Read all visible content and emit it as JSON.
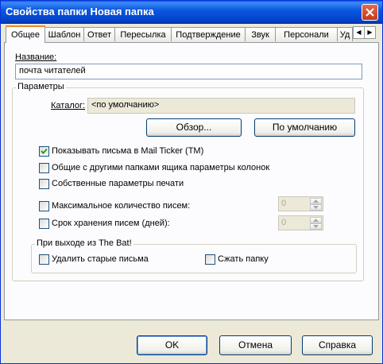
{
  "window": {
    "title": "Свойства папки Новая папка"
  },
  "tabs": [
    {
      "label": "Общее"
    },
    {
      "label": "Шаблон"
    },
    {
      "label": "Ответ"
    },
    {
      "label": "Пересылка"
    },
    {
      "label": "Подтверждение"
    },
    {
      "label": "Звук"
    },
    {
      "label": "Персонали"
    },
    {
      "label": "Уд"
    }
  ],
  "general": {
    "name_label": "Название:",
    "name_value": "почта читателей",
    "params_title": "Параметры",
    "catalog_label": "Каталог:",
    "catalog_value": "<по умолчанию>",
    "browse_button": "Обзор...",
    "default_button": "По умолчанию",
    "options": [
      {
        "label": "Показывать письма в Mail Ticker (TM)",
        "checked": true
      },
      {
        "label": "Общие с другими папками ящика параметры колонок",
        "checked": false
      },
      {
        "label": "Собственные параметры печати",
        "checked": false
      }
    ],
    "max_messages": {
      "label": "Максимальное количество писем:",
      "checked": false,
      "value": "0"
    },
    "retention_days": {
      "label": "Срок хранения писем (дней):",
      "checked": false,
      "value": "0"
    },
    "on_exit": {
      "title": "При выходе из The Bat!",
      "delete_old": {
        "label": "Удалить старые письма",
        "checked": false
      },
      "compress": {
        "label": "Сжать папку",
        "checked": false
      }
    }
  },
  "footer": {
    "ok": "OK",
    "cancel": "Отмена",
    "help": "Справка"
  }
}
